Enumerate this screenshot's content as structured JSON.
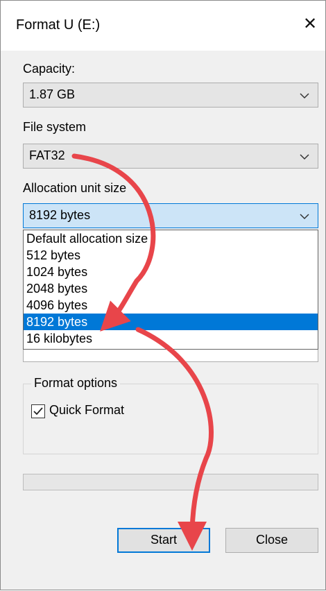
{
  "window": {
    "title": "Format U (E:)",
    "close_glyph": "✕"
  },
  "capacity": {
    "label": "Capacity:",
    "value": "1.87 GB"
  },
  "file_system": {
    "label": "File system",
    "value": "FAT32"
  },
  "allocation_unit": {
    "label": "Allocation unit size",
    "value": "8192 bytes",
    "options": [
      "Default allocation size",
      "512 bytes",
      "1024 bytes",
      "2048 bytes",
      "4096 bytes",
      "8192 bytes",
      "16 kilobytes"
    ],
    "selected_index": 5
  },
  "format_options": {
    "label": "Format options",
    "quick_format_label": "Quick Format",
    "quick_format_checked": true
  },
  "progress": {
    "value": 0
  },
  "buttons": {
    "start_label": "Start",
    "close_label": "Close"
  },
  "colors": {
    "selection": "#0078d7",
    "annotation_arrow": "#e8454a"
  }
}
